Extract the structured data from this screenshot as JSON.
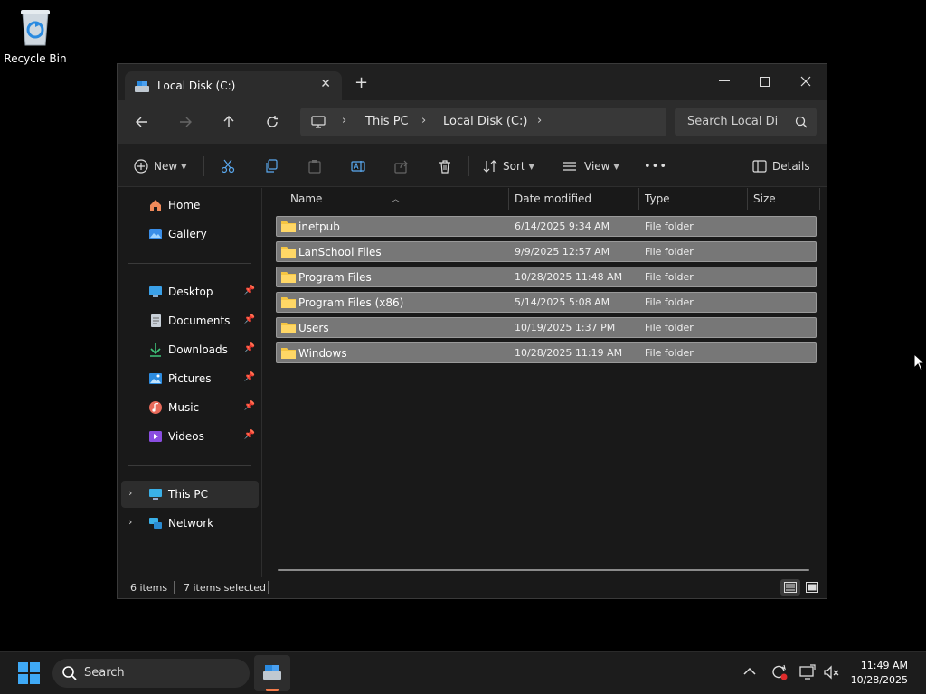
{
  "desktop": {
    "recycle_bin_label": "Recycle Bin"
  },
  "window": {
    "tab_title": "Local Disk (C:)",
    "new_tab_label": "+",
    "breadcrumb": [
      "This PC",
      "Local Disk (C:)"
    ],
    "search_placeholder": "Search Local Dis"
  },
  "toolbar": {
    "new_label": "New",
    "sort_label": "Sort",
    "view_label": "View",
    "more_label": "•••",
    "details_label": "Details"
  },
  "sidebar": {
    "home": "Home",
    "gallery": "Gallery",
    "pinned": [
      {
        "label": "Desktop"
      },
      {
        "label": "Documents"
      },
      {
        "label": "Downloads"
      },
      {
        "label": "Pictures"
      },
      {
        "label": "Music"
      },
      {
        "label": "Videos"
      }
    ],
    "this_pc": "This PC",
    "network": "Network"
  },
  "columns": {
    "name": "Name",
    "date": "Date modified",
    "type": "Type",
    "size": "Size"
  },
  "files": [
    {
      "name": "inetpub",
      "date": "6/14/2025 9:34 AM",
      "type": "File folder"
    },
    {
      "name": "LanSchool Files",
      "date": "9/9/2025 12:57 AM",
      "type": "File folder"
    },
    {
      "name": "Program Files",
      "date": "10/28/2025 11:48 AM",
      "type": "File folder"
    },
    {
      "name": "Program Files (x86)",
      "date": "5/14/2025 5:08 AM",
      "type": "File folder"
    },
    {
      "name": "Users",
      "date": "10/19/2025 1:37 PM",
      "type": "File folder"
    },
    {
      "name": "Windows",
      "date": "10/28/2025 11:19 AM",
      "type": "File folder"
    }
  ],
  "status": {
    "items": "6 items",
    "selected": "7 items selected"
  },
  "taskbar": {
    "search_placeholder": "Search",
    "time": "11:49 AM",
    "date": "10/28/2025"
  },
  "colors": {
    "selection_row": "#777777",
    "folder": "#f5c542",
    "accent_orange": "#f47b4a"
  }
}
